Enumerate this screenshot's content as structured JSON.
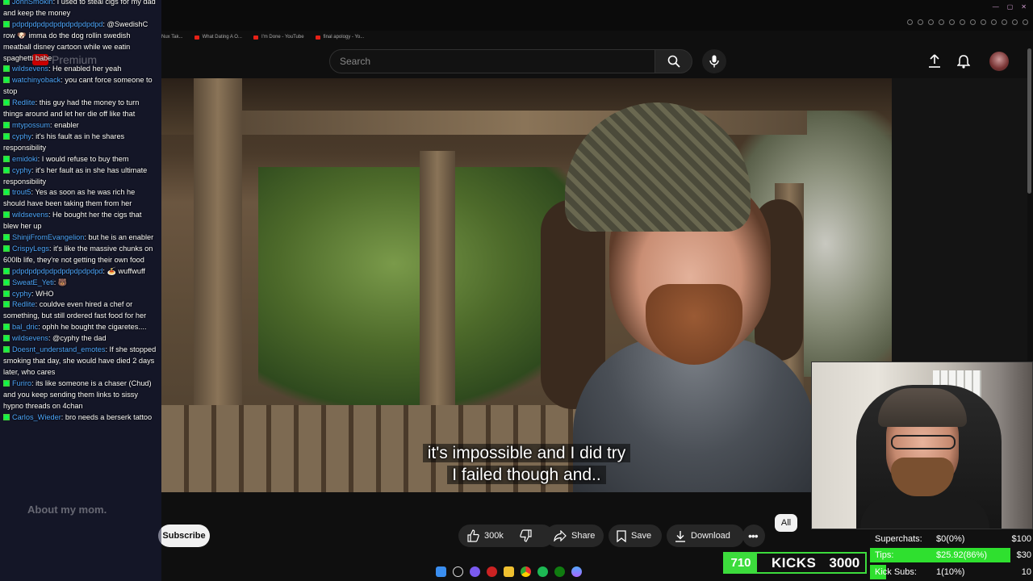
{
  "browser": {
    "bookmarks": [
      "Nux Tak...",
      "What Dating A O...",
      "I'm Done - YouTube",
      "final apology - Yo..."
    ]
  },
  "youtube": {
    "search_placeholder": "Search",
    "premium_label": "Premium",
    "subtitle_lines": [
      "it's impossible and I did try",
      "I failed though and.."
    ],
    "subscribe_label": "Subscribe",
    "like_count": "300k",
    "share_label": "Share",
    "save_label": "Save",
    "download_label": "Download",
    "chip_all": "All",
    "ghost_channel_text": "About my mom."
  },
  "chat": {
    "messages": [
      {
        "user": "JohnSmokin",
        "text": "I used to steal cigs for my dad and keep the money"
      },
      {
        "user": "pdpdpdpdpdpdpdpdpdpdpd",
        "text": "@SwedishC row 🐶 imma do the dog rollin swedish meatball disney cartoon while we eatin spaghetti babe"
      },
      {
        "user": "wildsevens",
        "text": "He enabled her yeah"
      },
      {
        "user": "watchinyoback",
        "text": "you cant force someone to stop"
      },
      {
        "user": "Redlite",
        "text": "this guy had the money to turn things around and let her die off like that"
      },
      {
        "user": "mtypossum",
        "text": "enabler"
      },
      {
        "user": "cyphy",
        "text": "it's his fault as in he shares responsibility"
      },
      {
        "user": "emidoki",
        "text": "I would refuse to buy them"
      },
      {
        "user": "cyphy",
        "text": "it's her fault as in she has ultimate responsibility"
      },
      {
        "user": "trout5",
        "text": "Yes as soon as he was rich he should have been taking them from her"
      },
      {
        "user": "wildsevens",
        "text": "He bought her the cigs that blew her up"
      },
      {
        "user": "ShinjiFromEvangelion",
        "text": "but he is an enabler"
      },
      {
        "user": "CrispyLegs",
        "text": "it's like the massive chunks on 600lb life, they're not getting their own food"
      },
      {
        "user": "pdpdpdpdpdpdpdpdpdpdpd",
        "text": "🍝 wuffwuff"
      },
      {
        "user": "SweatE_Yeti",
        "text": "🐻"
      },
      {
        "user": "cyphy",
        "text": "WHO"
      },
      {
        "user": "Redlite",
        "text": "couldve even hired a chef or something, but still ordered fast food for her"
      },
      {
        "user": "bal_dric",
        "text": "ophh he bought the cigaretes...."
      },
      {
        "user": "wildsevens",
        "text": "@cyphy the dad"
      },
      {
        "user": "Doesnt_understand_emotes",
        "text": "If she stopped smoking that day, she would have died 2 days later, who cares"
      },
      {
        "user": "Furiro",
        "text": "its like someone is a chaser (Chud) and you keep sending them links to sissy hypno threads on 4chan"
      },
      {
        "user": "Carlos_Wieder",
        "text": "bro needs a berserk tattoo"
      }
    ]
  },
  "kicks": {
    "count": "710",
    "label": "KICKS",
    "goal": "3000"
  },
  "stats": {
    "superchats": {
      "label": "Superchats:",
      "value": "$0(0%)",
      "goal": "$100",
      "fraction": 0.0
    },
    "tips": {
      "label": "Tips:",
      "value": "$25.92(86%)",
      "goal": "$30",
      "fraction": 0.86
    },
    "kick_subs": {
      "label": "Kick Subs:",
      "value": "1(10%)",
      "goal": "10",
      "fraction": 0.1
    }
  },
  "colors": {
    "accent_green": "#3cdc3c",
    "username_blue": "#4fa8ff",
    "youtube_red": "#e62117"
  }
}
